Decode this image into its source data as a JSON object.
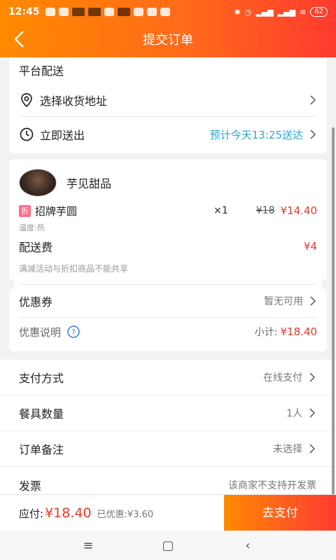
{
  "status_bar": {
    "time": "12:45",
    "battery": "62"
  },
  "header": {
    "title": "提交订单"
  },
  "delivery": {
    "section_title": "平台配送",
    "address_label": "选择收货地址",
    "time_label": "立即送出",
    "time_value": "预计今天13:25送达"
  },
  "store": {
    "name": "芋见甜品",
    "item": {
      "discount_badge": "折",
      "name": "招牌芋圆",
      "spec": "温度:热",
      "quantity": "×1",
      "original_price": "¥18",
      "price": "¥14.40"
    },
    "delivery_fee_label": "配送费",
    "delivery_fee_value": "¥4",
    "promo_note": "满减活动与折扣商品不能共享",
    "coupon_label": "优惠券",
    "coupon_value": "暂无可用",
    "discount_info_label": "优惠说明",
    "subtotal_label": "小计:",
    "subtotal_value": "¥18.40"
  },
  "options": {
    "payment_label": "支付方式",
    "payment_value": "在线支付",
    "tableware_label": "餐具数量",
    "tableware_value": "1人",
    "remark_label": "订单备注",
    "remark_value": "未选择",
    "invoice_label": "发票",
    "invoice_value": "该商家不支持开发票"
  },
  "footer": {
    "due_label": "应付:",
    "due_value": "¥18.40",
    "saved_text": "已优惠:¥3.60",
    "pay_button": "去支付"
  },
  "colors": {
    "brand_orange": "#ff8a00",
    "brand_red": "#ff3b2f",
    "price_red": "#e53a2a",
    "eta_blue": "#2aa4d8"
  }
}
